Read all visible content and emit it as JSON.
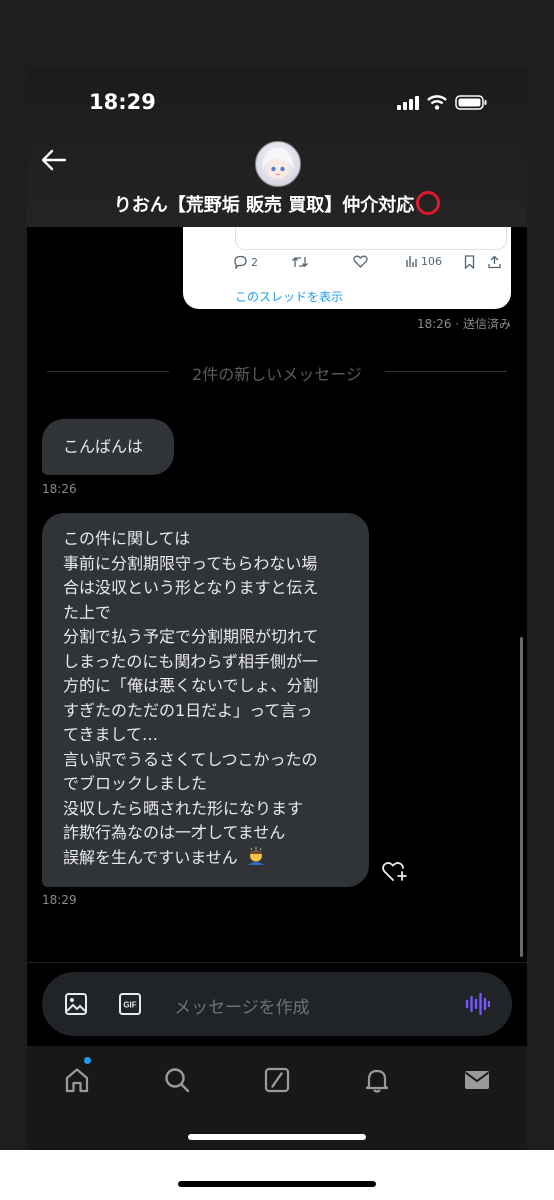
{
  "status_bar": {
    "time": "18:29"
  },
  "header": {
    "title": "りおん【荒野垢 販売 買取】仲介対応",
    "title_emoji": "red-circle-icon"
  },
  "shared_tweet": {
    "replies": "2",
    "views": "106",
    "thread_link": "このスレッドを表示",
    "timestamp": "18:26 · 送信済み"
  },
  "divider": {
    "text": "2件の新しいメッセージ"
  },
  "messages": [
    {
      "text": "こんばんは",
      "time": "18:26"
    },
    {
      "lines": [
        "この件に関しては",
        "事前に分割期限守ってもらわない場",
        "合は没収という形となりますと伝え",
        "た上で",
        "分割で払う予定で分割期限が切れて",
        "しまったのにも関わらず相手側が一",
        "方的に「俺は悪くないでしょ、分割",
        "すぎたのただの1日だよ」って言っ",
        "てきまして…",
        "言い訳でうるさくてしつこかったの",
        "でブロックしました",
        "没収したら晒された形になります",
        "詐欺行為なのは一才してません",
        "誤解を生んですいません"
      ],
      "emoji": "bowing-person-icon",
      "time": "18:29"
    }
  ],
  "composer": {
    "placeholder": "メッセージを作成"
  },
  "tabs": [
    "home-icon",
    "search-icon",
    "grok-icon",
    "notifications-icon",
    "messages-icon"
  ],
  "colors": {
    "accent": "#1d9bf0",
    "bubble": "#303438",
    "voice": "#7856ff",
    "red_circle": "#e0182d"
  }
}
